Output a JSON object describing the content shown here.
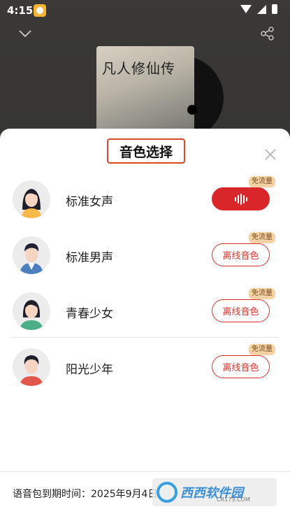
{
  "status_bar": {
    "time": "4:15"
  },
  "player": {
    "cover_title": "凡人修仙传"
  },
  "sheet": {
    "title": "音色选择",
    "voices": [
      {
        "name": "标准女声",
        "badge": "免流量",
        "button": "",
        "selected": true
      },
      {
        "name": "标准男声",
        "badge": "免流量",
        "button": "离线音色",
        "selected": false
      },
      {
        "name": "青春少女",
        "badge": "免流量",
        "button": "离线音色",
        "selected": false
      },
      {
        "name": "阳光少年",
        "badge": "免流量",
        "button": "离线音色",
        "selected": false
      }
    ],
    "expire_text": "语音包到期时间：2025年9月4日"
  },
  "watermark": {
    "text": "西西软件园",
    "sub": "CR173.COM"
  },
  "colors": {
    "accent": "#d9262b",
    "badge_bg": "#f5d3a6",
    "title_border": "#d9482b"
  }
}
